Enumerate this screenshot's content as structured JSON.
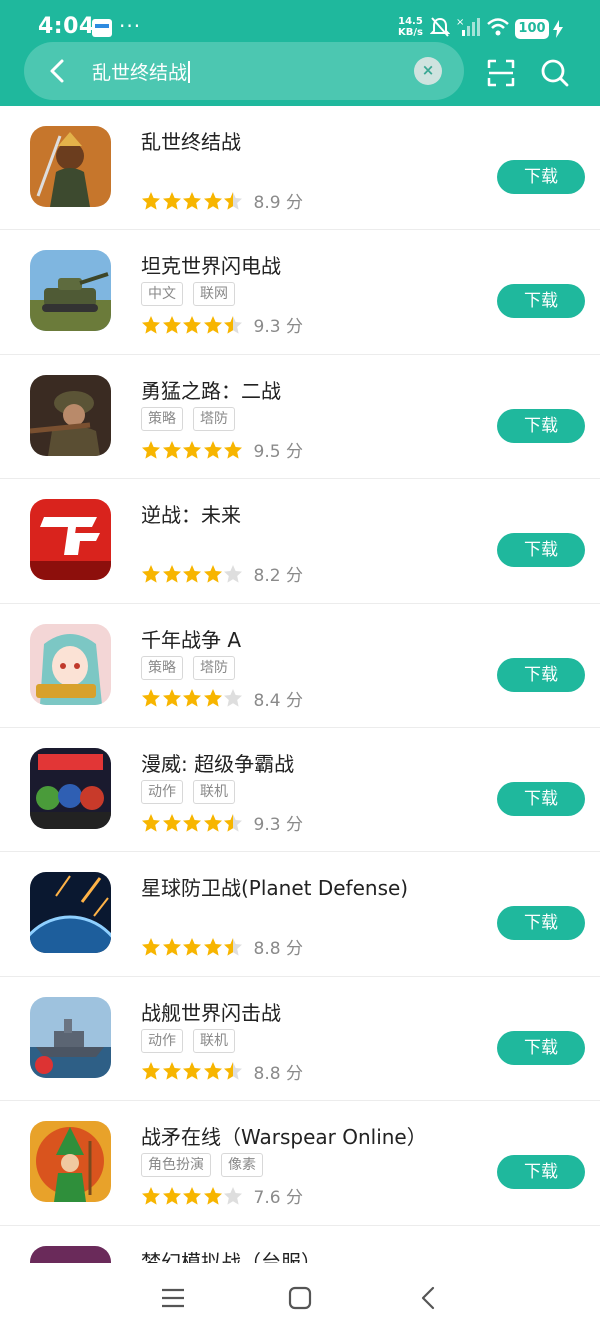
{
  "status": {
    "time": "4:04",
    "dots": "···",
    "speed_value": "14.5",
    "speed_unit": "KB/s",
    "battery": "100"
  },
  "search": {
    "query": "乱世终结战",
    "clear_symbol": "×"
  },
  "colors": {
    "accent": "#1fb89d",
    "star": "#f7b500",
    "star_empty": "#dedede"
  },
  "download_label": "下载",
  "score_unit": "分",
  "apps": [
    {
      "name": "乱世终结战",
      "tags": [],
      "stars": 4.5,
      "score": "8.9",
      "icon": "warrior-icon"
    },
    {
      "name": "坦克世界闪电战",
      "tags": [
        "中文",
        "联网"
      ],
      "stars": 4.5,
      "score": "9.3",
      "icon": "tank-icon"
    },
    {
      "name": "勇猛之路：二战",
      "tags": [
        "策略",
        "塔防"
      ],
      "stars": 5,
      "score": "9.5",
      "icon": "soldier-icon"
    },
    {
      "name": "逆战：未来",
      "tags": [],
      "stars": 4,
      "score": "8.2",
      "icon": "tf-logo-icon"
    },
    {
      "name": "千年战争 A",
      "tags": [
        "策略",
        "塔防"
      ],
      "stars": 4,
      "score": "8.4",
      "icon": "anime-girl-icon"
    },
    {
      "name": "漫威: 超级争霸战",
      "tags": [
        "动作",
        "联机"
      ],
      "stars": 4.5,
      "score": "9.3",
      "icon": "marvel-heroes-icon"
    },
    {
      "name": "星球防卫战(Planet Defense)",
      "tags": [],
      "stars": 4.5,
      "score": "8.8",
      "icon": "planet-meteor-icon"
    },
    {
      "name": "战舰世界闪击战",
      "tags": [
        "动作",
        "联机"
      ],
      "stars": 4.5,
      "score": "8.8",
      "icon": "battleship-icon"
    },
    {
      "name": "战矛在线（Warspear Online）",
      "tags": [
        "角色扮演",
        "像素"
      ],
      "stars": 4,
      "score": "7.6",
      "icon": "wizard-icon"
    },
    {
      "name": "梦幻模拟战（台服）",
      "tags": [],
      "stars": 0,
      "score": "",
      "icon": "fantasy-icon"
    }
  ]
}
